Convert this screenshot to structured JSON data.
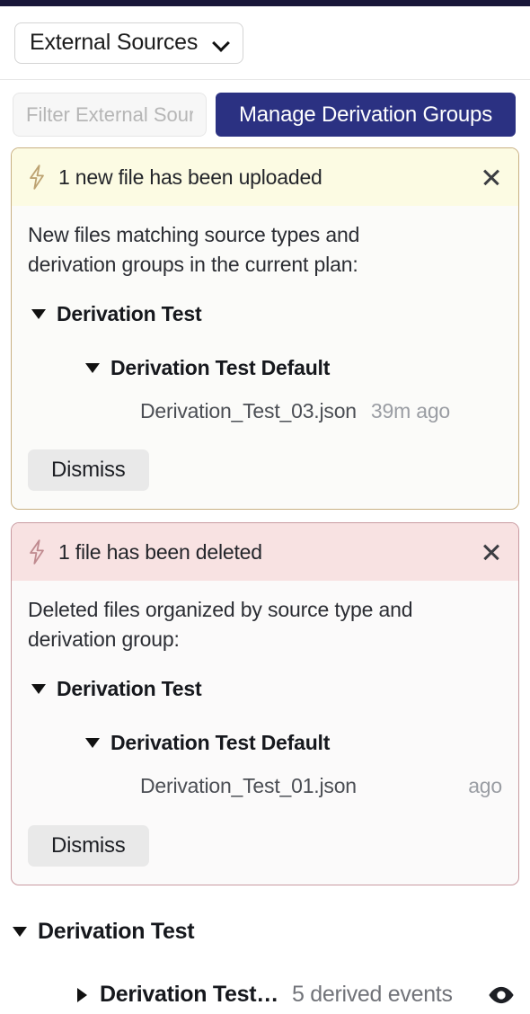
{
  "topbar": {
    "color": "#191639"
  },
  "selector": {
    "label": "External Sources",
    "chevron_icon": "chevron-down-icon"
  },
  "toolbar": {
    "filter_placeholder": "Filter External Sources",
    "filter_value": "",
    "manage_button": "Manage Derivation Groups",
    "accent_color": "#2b3182"
  },
  "alerts": [
    {
      "variant": "warn",
      "icon": "zap-icon",
      "icon_color": "#bda372",
      "header_bg": "#fcfbe3",
      "border_color": "#c9b184",
      "title": "1 new file has been uploaded",
      "close_icon": "close-icon",
      "description": "New files matching source types and derivation groups in the current plan:",
      "source_type": "Derivation Test",
      "derivation_group": "Derivation Test Default",
      "file_name": "Derivation_Test_03.json",
      "file_time": "39m ago",
      "dismiss_label": "Dismiss"
    },
    {
      "variant": "err",
      "icon": "zap-icon",
      "icon_color": "#c08b90",
      "header_bg": "#f8e2e2",
      "border_color": "#c99ba1",
      "title": "1 file has been deleted",
      "close_icon": "close-icon",
      "description": "Deleted files organized by source type and derivation group:",
      "source_type": "Derivation Test",
      "derivation_group": "Derivation Test Default",
      "file_name": "Derivation_Test_01.json",
      "file_time": "ago",
      "dismiss_label": "Dismiss"
    }
  ],
  "source_tree": {
    "root_label": "Derivation Test",
    "child_label": "Derivation Test D...",
    "child_count": "5 derived events",
    "visibility_icon": "eye-icon"
  }
}
